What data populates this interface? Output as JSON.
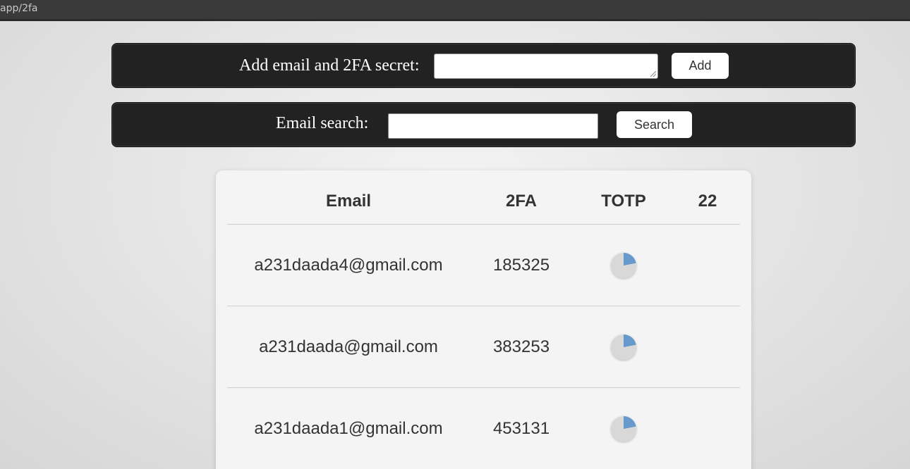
{
  "browser": {
    "url": "app/2fa"
  },
  "add_form": {
    "label": "Add email and 2FA secret:",
    "textarea_value": "",
    "button_label": "Add"
  },
  "search_form": {
    "label": "Email search:",
    "input_value": "",
    "button_label": "Search"
  },
  "table": {
    "headers": {
      "email": "Email",
      "twofa": "2FA",
      "totp": "TOTP",
      "seconds": "22"
    },
    "rows": [
      {
        "email": "a231daada4@gmail.com",
        "code": "185325",
        "totp_progress": 0.22
      },
      {
        "email": "a231daada@gmail.com",
        "code": "383253",
        "totp_progress": 0.22
      },
      {
        "email": "a231daada1@gmail.com",
        "code": "453131",
        "totp_progress": 0.22
      }
    ]
  },
  "colors": {
    "pie_fill": "#6699cc",
    "pie_bg": "#d8d8d8",
    "panel_bg": "#222222"
  },
  "icons": {
    "totp": "pie-timer-icon"
  }
}
